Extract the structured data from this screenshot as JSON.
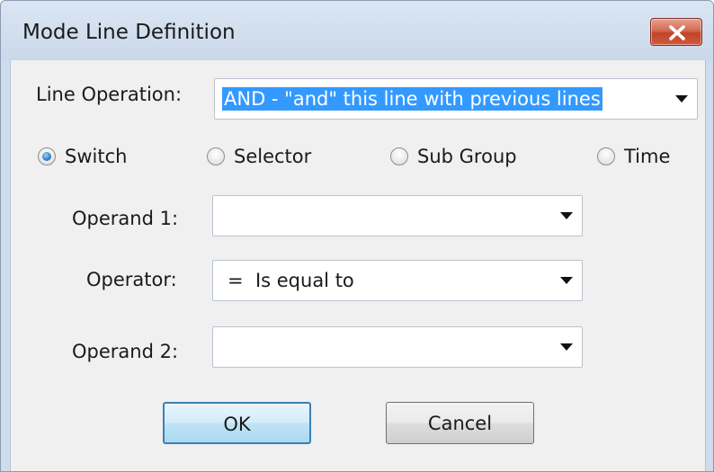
{
  "window": {
    "title": "Mode Line Definition",
    "close_symbol": "X"
  },
  "line_operation": {
    "label": "Line Operation:",
    "value": "AND - \"and\" this line with previous lines"
  },
  "radio_group": {
    "selected": "Switch",
    "options": [
      {
        "label": "Switch",
        "checked": true
      },
      {
        "label": "Selector",
        "checked": false
      },
      {
        "label": "Sub Group",
        "checked": false
      },
      {
        "label": "Time",
        "checked": false
      }
    ]
  },
  "operand1": {
    "label": "Operand 1:",
    "value": ""
  },
  "operator": {
    "label": "Operator:",
    "value": "=  Is equal to"
  },
  "operand2": {
    "label": "Operand 2:",
    "value": ""
  },
  "buttons": {
    "ok": "OK",
    "cancel": "Cancel"
  },
  "icons": {
    "close": "close-icon",
    "dropdown": "chevron-down-icon"
  }
}
